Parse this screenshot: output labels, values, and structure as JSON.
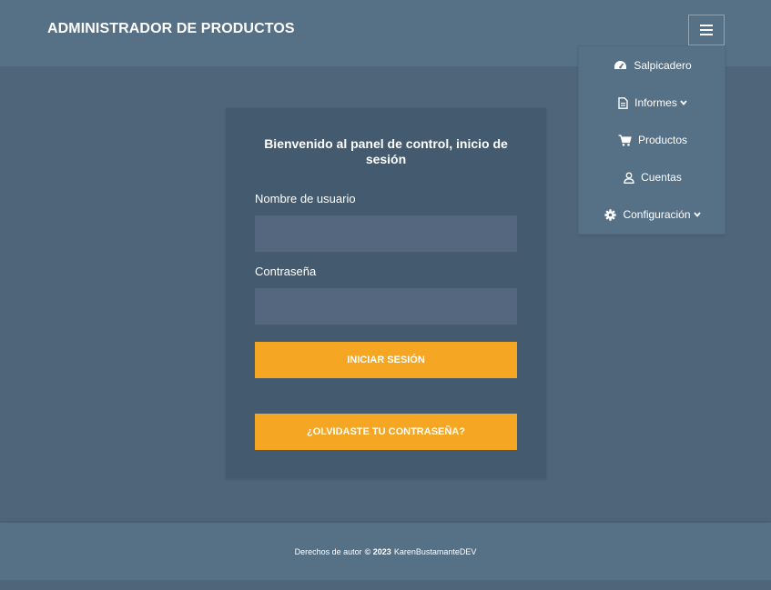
{
  "header": {
    "brand": "ADMINISTRADOR DE PRODUCTOS",
    "menu_icon": "hamburger-icon"
  },
  "menu": {
    "items": [
      {
        "label": "Salpicadero",
        "icon": "tachometer-icon"
      },
      {
        "label": "Informes",
        "icon": "file-icon",
        "has_submenu": true
      },
      {
        "label": "Productos",
        "icon": "shopping-cart-icon"
      },
      {
        "label": "Cuentas",
        "icon": "user-icon"
      },
      {
        "label": "Configuración",
        "icon": "gear-icon",
        "has_submenu": true
      }
    ]
  },
  "login": {
    "title": "Bienvenido al panel de control, inicio de sesión",
    "username_label": "Nombre de usuario",
    "username_value": "",
    "password_label": "Contraseña",
    "password_value": "",
    "login_button": "INICIAR SESIÓN",
    "forgot_button": "¿OLVIDASTE TU CONTRASEÑA?"
  },
  "footer": {
    "prefix": "Derechos de autor",
    "copyright": "© 2023",
    "author": "KarenBustamanteDEV"
  },
  "colors": {
    "background": "#4f657a",
    "header": "#567086",
    "card": "#435a6f",
    "input": "#55667f",
    "accent": "#f5a623"
  }
}
